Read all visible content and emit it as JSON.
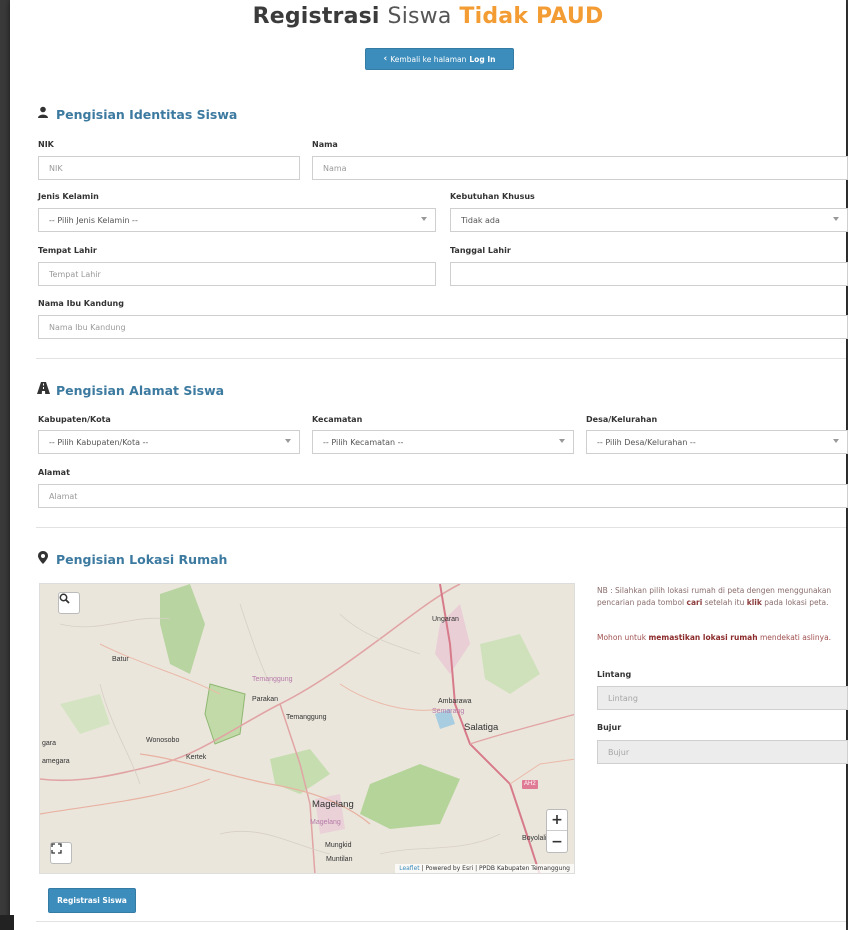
{
  "header": {
    "title_bold": "Registrasi",
    "title_light": "Siswa",
    "title_accent": "Tidak PAUD",
    "back_button_prefix": "Kembali ke halaman",
    "back_button_bold": "Log In"
  },
  "identitas": {
    "section_title": "Pengisian Identitas Siswa",
    "nik_label": "NIK",
    "nik_placeholder": "NIK",
    "nama_label": "Nama",
    "nama_placeholder": "Nama",
    "jk_label": "Jenis Kelamin",
    "jk_value": "-- Pilih Jenis Kelamin --",
    "kk_label": "Kebutuhan Khusus",
    "kk_value": "Tidak ada",
    "tempat_label": "Tempat Lahir",
    "tempat_placeholder": "Tempat Lahir",
    "tanggal_label": "Tanggal Lahir",
    "tanggal_value": "",
    "ibu_label": "Nama Ibu Kandung",
    "ibu_placeholder": "Nama Ibu Kandung"
  },
  "alamat": {
    "section_title": "Pengisian Alamat Siswa",
    "kab_label": "Kabupaten/Kota",
    "kab_value": "-- Pilih Kabupaten/Kota --",
    "kec_label": "Kecamatan",
    "kec_value": "-- Pilih Kecamatan --",
    "desa_label": "Desa/Kelurahan",
    "desa_value": "-- Pilih Desa/Kelurahan --",
    "alamat_label": "Alamat",
    "alamat_placeholder": "Alamat"
  },
  "lokasi": {
    "section_title": "Pengisian Lokasi Rumah",
    "nb_1": "NB : Silahkan pilih lokasi rumah di peta dengen menggunakan pencarian pada tombol",
    "nb_cari": "cari",
    "nb_2": "setelah itu",
    "nb_klik": "klik",
    "nb_3": "pada lokasi peta.",
    "nb2_1": "Mohon untuk",
    "nb2_bold": "memastikan lokasi rumah",
    "nb2_2": "mendekati aslinya.",
    "lintang_label": "Lintang",
    "lintang_placeholder": "Lintang",
    "bujur_label": "Bujur",
    "bujur_placeholder": "Bujur"
  },
  "map": {
    "places": {
      "ungaran": "Ungaran",
      "batur": "Batur",
      "temanggung_pink": "Temanggung",
      "parakan": "Parakan",
      "temanggung": "Temanggung",
      "ambarawa": "Ambarawa",
      "semarang": "Semarang",
      "salatiga": "Salatiga",
      "wonosobo": "Wonosobo",
      "kertek": "Kertek",
      "gara": "gara",
      "amegara": "amegara",
      "magelang": "Magelang",
      "magelang_pink": "Magelang",
      "mungkid": "Mungkid",
      "muntilan": "Muntilan",
      "boyolali": "Boyolali",
      "ah2": "AH2"
    },
    "attribution_leaflet": "Leaflet",
    "attribution_rest": "| Powered by Esri | PPDB Kabupaten Temanggung",
    "zoom_in": "+",
    "zoom_out": "−"
  },
  "footer": {
    "submit_label": "Registrasi Siswa"
  },
  "colors": {
    "primary": "#3c8dbc",
    "accent": "#f39c33",
    "section": "#3c7aa0"
  },
  "icons": {
    "user": "user-icon",
    "road": "road-icon",
    "marker": "map-marker-icon",
    "search": "search-icon",
    "fullscreen": "fullscreen-icon",
    "back": "chevron-left-icon"
  }
}
